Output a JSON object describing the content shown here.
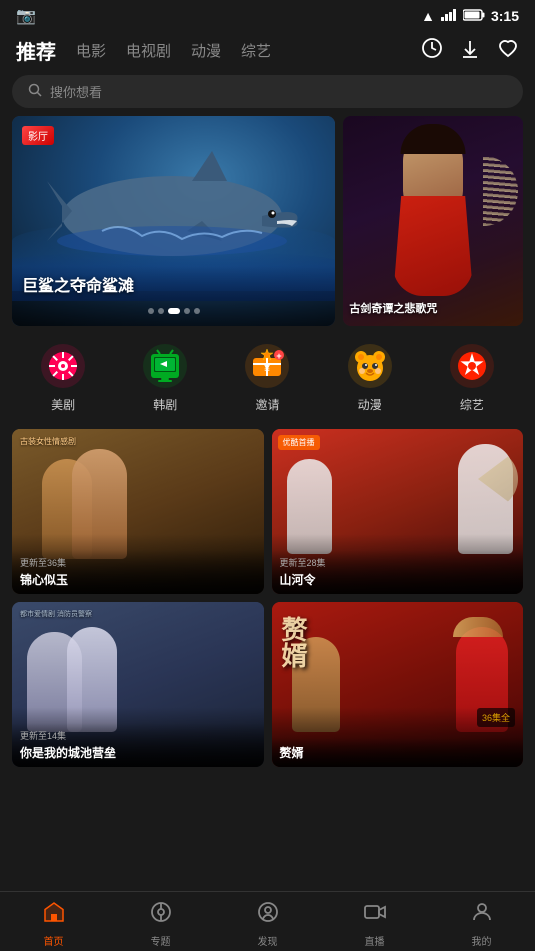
{
  "statusBar": {
    "time": "3:15",
    "cameraIcon": "📷"
  },
  "topNav": {
    "tabs": [
      {
        "id": "recommend",
        "label": "推荐",
        "active": true
      },
      {
        "id": "movie",
        "label": "电影",
        "active": false
      },
      {
        "id": "tvshow",
        "label": "电视剧",
        "active": false
      },
      {
        "id": "anime",
        "label": "动漫",
        "active": false
      },
      {
        "id": "variety",
        "label": "综艺",
        "active": false
      }
    ],
    "icons": {
      "history": "🕐",
      "download": "⬇",
      "heart": "♡"
    }
  },
  "searchBar": {
    "placeholder": "搜你想看",
    "icon": "🔍"
  },
  "heroBanner": {
    "main": {
      "title": "巨鲨之夺命鲨滩",
      "badge": "影厅",
      "dots": [
        false,
        false,
        true,
        false,
        false
      ]
    },
    "side": {
      "title": "古剑奇谭之悲歌咒"
    }
  },
  "categories": [
    {
      "id": "us-drama",
      "label": "美剧",
      "icon": "🎬",
      "color": "#f05"
    },
    {
      "id": "kr-drama",
      "label": "韩剧",
      "icon": "📺",
      "color": "#0a0"
    },
    {
      "id": "invite",
      "label": "邀请",
      "icon": "🎁",
      "color": "#f80",
      "special": true
    },
    {
      "id": "anime",
      "label": "动漫",
      "icon": "🐻",
      "color": "#fa0"
    },
    {
      "id": "variety2",
      "label": "综艺",
      "icon": "⭐",
      "color": "#f00"
    }
  ],
  "contentCards": [
    {
      "id": "jinxin",
      "title": "锦心似玉",
      "update": "更新至36集",
      "badge": ""
    },
    {
      "id": "shanhe",
      "title": "山河令",
      "update": "更新至28集",
      "badge": "优酷首播"
    },
    {
      "id": "chengchi",
      "title": "你是我的城池营垒",
      "update": "更新至14集",
      "badge": ""
    },
    {
      "id": "zanshen",
      "title": "赘婿",
      "update": "",
      "episodes": "36集全"
    }
  ],
  "bottomNav": [
    {
      "id": "home",
      "label": "首页",
      "icon": "🏠",
      "active": true
    },
    {
      "id": "topics",
      "label": "专题",
      "icon": "📍",
      "active": false
    },
    {
      "id": "discover",
      "label": "发现",
      "icon": "😊",
      "active": false
    },
    {
      "id": "live",
      "label": "直播",
      "icon": "📹",
      "active": false
    },
    {
      "id": "mine",
      "label": "我的",
      "icon": "👤",
      "active": false
    }
  ]
}
